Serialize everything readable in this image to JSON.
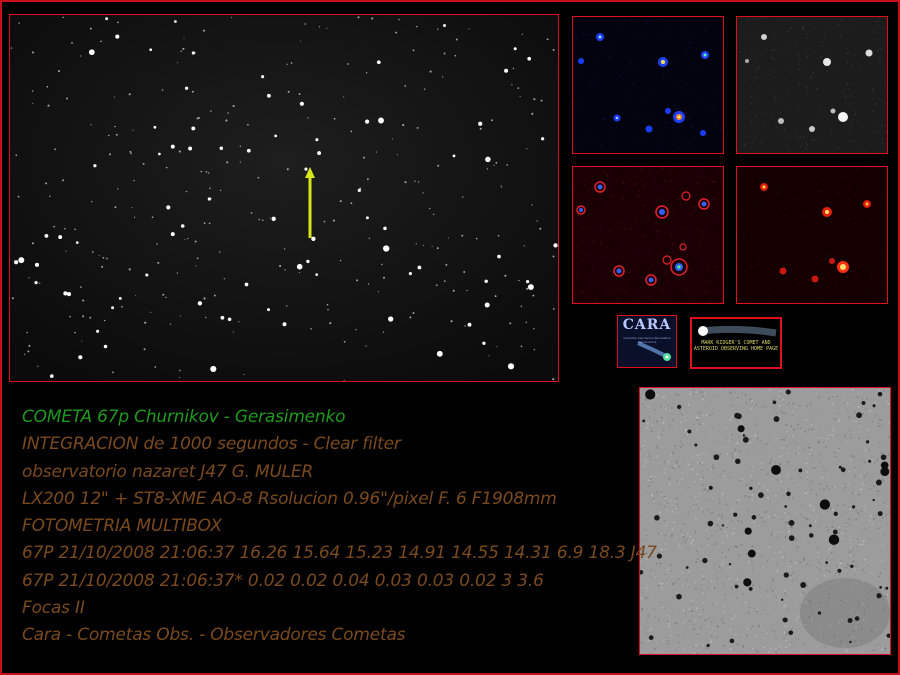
{
  "text_lines": [
    {
      "text": "COMETA   67p Churnikov - Gerasimenko",
      "color": "#1f9a1f"
    },
    {
      "text": "INTEGRACION de 1000  segundos - Clear filter",
      "color": "#7a4a1e"
    },
    {
      "text": "observatorio nazaret J47  G. MULER",
      "color": "#7a4a1e"
    },
    {
      "text": "LX200 12\" +  ST8-XME AO-8  Rsolucion 0.96\"/pixel   F. 6      F1908mm",
      "color": "#7a4a1e"
    },
    {
      "text": "FOTOMETRIA MULTIBOX",
      "color": "#7a4a1e"
    },
    {
      "text": "67P 21/10/2008 21:06:37 16.26 15.64 15.23 14.91 14.55 14.31 6.9 18.3 J47",
      "color": "#7a4a1e"
    },
    {
      "text": "67P 21/10/2008 21:06:37* 0.02 0.02 0.04 0.03 0.03 0.02 3 3.6",
      "color": "#7a4a1e"
    },
    {
      "text": "Focas II",
      "color": "#7a4a1e"
    },
    {
      "text": "Cara - Cometas Obs. - Observadores Cometas",
      "color": "#7a4a1e"
    }
  ],
  "logos": {
    "cara_title": "CARA",
    "cara_subtitle": "Cometas Asociacion Recreativa Astronomica",
    "kidger_text": "MARK KIDGER'S COMET AND ASTEROID OBSERVING HOME PAGE"
  },
  "colors": {
    "frame_border": "#c8101a",
    "panel_border": "#e0101a",
    "comet_arrow": "#d7e61a",
    "title_green": "#1f9a1f",
    "text_brown": "#7a4a1e"
  }
}
